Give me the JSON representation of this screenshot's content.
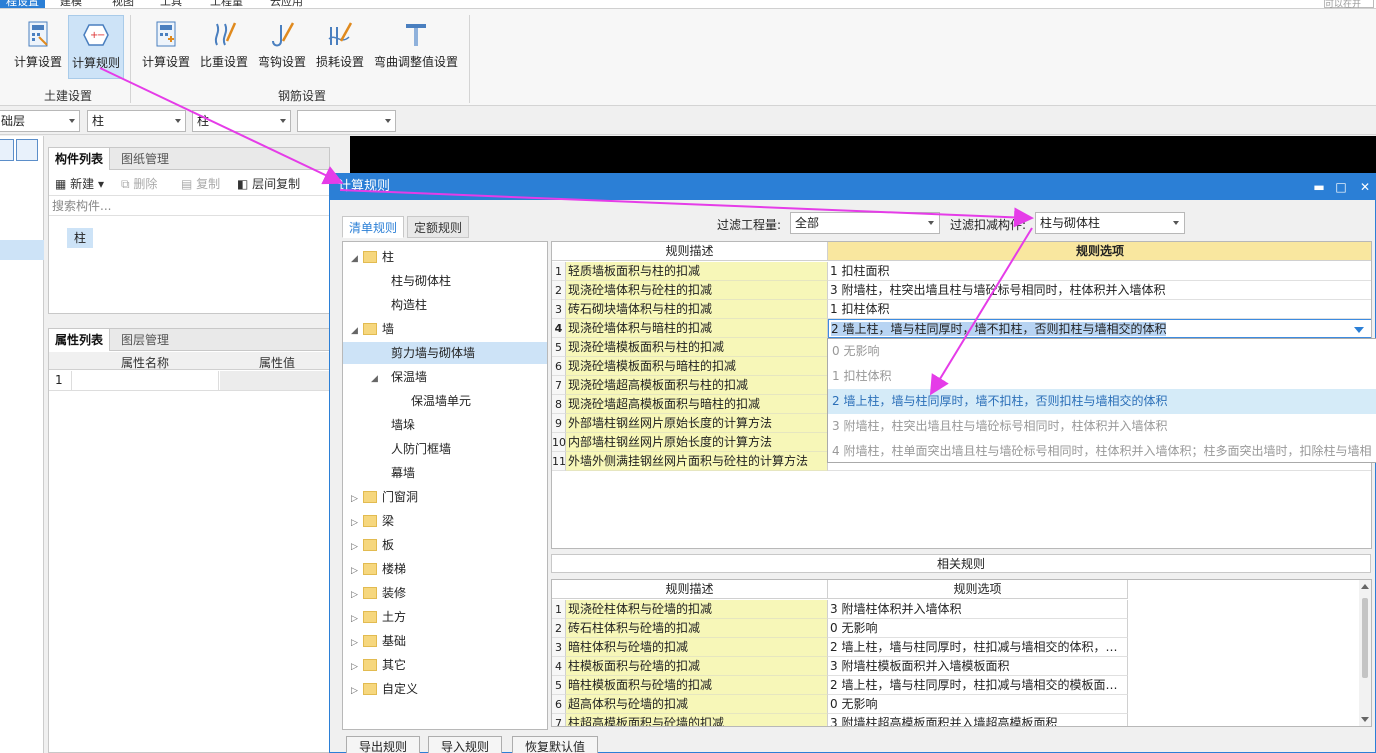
{
  "menubar": {
    "tabs": [
      "程设置",
      "建模",
      "视图",
      "工具",
      "工程量",
      "云应用"
    ],
    "search_placeholder": "可以在开"
  },
  "ribbon": {
    "tujian": {
      "calc_settings": "计算设置",
      "calc_rules": "计算规则",
      "group": "土建设置"
    },
    "gangjin": {
      "calc_settings": "计算设置",
      "weight_settings": "比重设置",
      "hook_settings": "弯钩设置",
      "loss_settings": "损耗设置",
      "bend_settings": "弯曲调整值设置",
      "group": "钢筋设置"
    }
  },
  "combos": [
    "础层",
    "柱",
    "柱",
    ""
  ],
  "component_panel": {
    "tabs": [
      "构件列表",
      "图纸管理"
    ],
    "toolbar": {
      "new": "新建",
      "delete": "删除",
      "copy": "复制",
      "floor_copy": "层间复制"
    },
    "search_placeholder": "搜索构件...",
    "item": "柱"
  },
  "property_panel": {
    "tabs": [
      "属性列表",
      "图层管理"
    ],
    "headers": [
      "属性名称",
      "属性值"
    ],
    "row_num": "1"
  },
  "dialog": {
    "title": "计算规则",
    "controls": [
      "▬",
      "□",
      "✕"
    ],
    "tabs": [
      "清单规则",
      "定额规则"
    ],
    "filter_qty_label": "过滤工程量:",
    "filter_qty_value": "全部",
    "filter_comp_label": "过滤扣减构件:",
    "filter_comp_value": "柱与砌体柱",
    "tree": [
      {
        "label": "柱",
        "level": 0,
        "folder": true,
        "toggle": "◢"
      },
      {
        "label": "柱与砌体柱",
        "level": 1,
        "folder": false,
        "toggle": ""
      },
      {
        "label": "构造柱",
        "level": 1,
        "folder": false,
        "toggle": ""
      },
      {
        "label": "墙",
        "level": 0,
        "folder": true,
        "toggle": "◢"
      },
      {
        "label": "剪力墙与砌体墙",
        "level": 1,
        "folder": false,
        "toggle": ""
      },
      {
        "label": "保温墙",
        "level": 1,
        "folder": false,
        "toggle": "◢"
      },
      {
        "label": "保温墙单元",
        "level": 2,
        "folder": false,
        "toggle": ""
      },
      {
        "label": "墙垛",
        "level": 1,
        "folder": false,
        "toggle": ""
      },
      {
        "label": "人防门框墙",
        "level": 1,
        "folder": false,
        "toggle": ""
      },
      {
        "label": "幕墙",
        "level": 1,
        "folder": false,
        "toggle": ""
      },
      {
        "label": "门窗洞",
        "level": 0,
        "folder": true,
        "toggle": "▷"
      },
      {
        "label": "梁",
        "level": 0,
        "folder": true,
        "toggle": "▷"
      },
      {
        "label": "板",
        "level": 0,
        "folder": true,
        "toggle": "▷"
      },
      {
        "label": "楼梯",
        "level": 0,
        "folder": true,
        "toggle": "▷"
      },
      {
        "label": "装修",
        "level": 0,
        "folder": true,
        "toggle": "▷"
      },
      {
        "label": "土方",
        "level": 0,
        "folder": true,
        "toggle": "▷"
      },
      {
        "label": "基础",
        "level": 0,
        "folder": true,
        "toggle": "▷"
      },
      {
        "label": "其它",
        "level": 0,
        "folder": true,
        "toggle": "▷"
      },
      {
        "label": "自定义",
        "level": 0,
        "folder": true,
        "toggle": "▷"
      }
    ],
    "grid_headers": [
      "规则描述",
      "规则选项"
    ],
    "rules": [
      {
        "num": "1",
        "desc": "轻质墙板面积与柱的扣减",
        "opt": "1   扣柱面积"
      },
      {
        "num": "2",
        "desc": "现浇砼墙体积与砼柱的扣减",
        "opt": "3   附墙柱，柱突出墙且柱与墙砼标号相同时，柱体积并入墙体积"
      },
      {
        "num": "3",
        "desc": "砖石砌块墙体积与柱的扣减",
        "opt": "1   扣柱体积"
      },
      {
        "num": "4",
        "desc": "现浇砼墙体积与暗柱的扣减",
        "opt": "2  墙上柱，墙与柱同厚时，墙不扣柱，否则扣柱与墙相交的体积"
      },
      {
        "num": "5",
        "desc": "现浇砼墙模板面积与柱的扣减",
        "opt": ""
      },
      {
        "num": "6",
        "desc": "现浇砼墙模板面积与暗柱的扣减",
        "opt": ""
      },
      {
        "num": "7",
        "desc": "现浇砼墙超高模板面积与柱的扣减",
        "opt": ""
      },
      {
        "num": "8",
        "desc": "现浇砼墙超高模板面积与暗柱的扣减",
        "opt": ""
      },
      {
        "num": "9",
        "desc": "外部墙柱钢丝网片原始长度的计算方法",
        "opt": ""
      },
      {
        "num": "10",
        "desc": "内部墙柱钢丝网片原始长度的计算方法",
        "opt": ""
      },
      {
        "num": "11",
        "desc": "外墙外侧满挂钢丝网片面积与砼柱的计算方法",
        "opt": ""
      }
    ],
    "dropdown": [
      "0   无影响",
      "1   扣柱体积",
      "2  墙上柱，墙与柱同厚时，墙不扣柱，否则扣柱与墙相交的体积",
      "3   附墙柱，柱突出墙且柱与墙砼标号相同时，柱体积并入墙体积",
      "4   附墙柱，柱单面突出墙且柱与墙砼标号相同时，柱体积并入墙体积；柱多面突出墙时，扣除柱与墙相"
    ],
    "related_label": "相关规则",
    "related_headers": [
      "规则描述",
      "规则选项"
    ],
    "related": [
      {
        "num": "1",
        "desc": "现浇砼柱体积与砼墙的扣减",
        "opt": "3 附墙柱体积并入墙体积"
      },
      {
        "num": "2",
        "desc": "砖石柱体积与砼墙的扣减",
        "opt": "0   无影响"
      },
      {
        "num": "3",
        "desc": "暗柱体积与砼墙的扣减",
        "opt": "2 墙上柱，墙与柱同厚时，柱扣减与墙相交的体积，…"
      },
      {
        "num": "4",
        "desc": "柱模板面积与砼墙的扣减",
        "opt": "3 附墙柱模板面积并入墙模板面积"
      },
      {
        "num": "5",
        "desc": "暗柱模板面积与砼墙的扣减",
        "opt": "2 墙上柱，墙与柱同厚时，柱扣减与墙相交的模板面…"
      },
      {
        "num": "6",
        "desc": "超高体积与砼墙的扣减",
        "opt": "0   无影响"
      },
      {
        "num": "7",
        "desc": "柱超高模板面积与砼墙的扣减",
        "opt": "3 附墙柱超高模板面积并入墙超高模板面积"
      }
    ],
    "buttons": {
      "export": "导出规则",
      "import": "导入规则",
      "restore": "恢复默认值"
    }
  },
  "colors": {
    "accent": "#2b7fd6",
    "desc_bg": "#f7f7b8",
    "header_hl": "#f9e79f",
    "selection": "#cde3f7",
    "annotation": "#e53ce8"
  }
}
